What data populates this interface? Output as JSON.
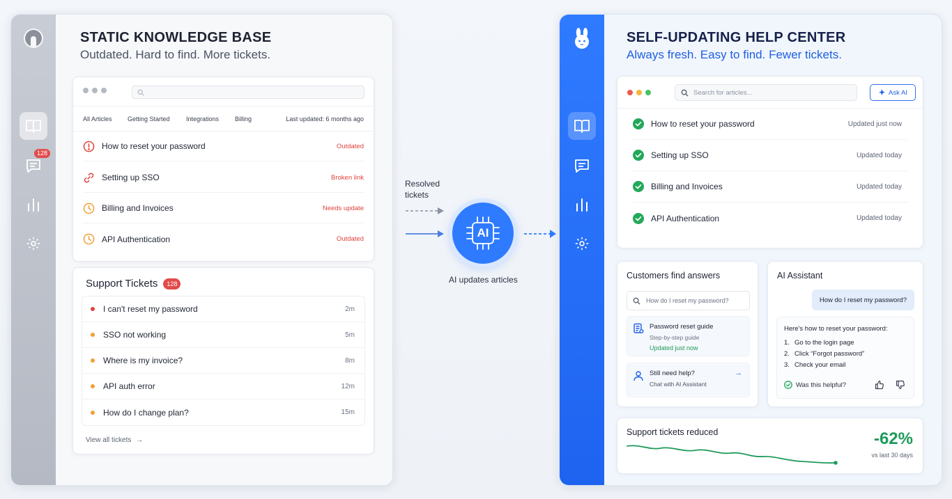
{
  "left_panel": {
    "title": "STATIC KNOWLEDGE BASE",
    "subtitle": "Outdated. Hard to find. More tickets.",
    "rail": {
      "chat_badge": "128"
    },
    "kb": {
      "tabs": [
        "All Articles",
        "Getting Started",
        "Integrations",
        "Billing"
      ],
      "last_updated": "Last updated: 6 months ago",
      "articles": [
        {
          "title": "How to reset your password",
          "status": "Outdated",
          "icon": "alert-circle-icon"
        },
        {
          "title": "Setting up SSO",
          "status": "Broken link",
          "icon": "broken-link-icon"
        },
        {
          "title": "Billing and Invoices",
          "status": "Needs update",
          "icon": "clock-icon"
        },
        {
          "title": "API Authentication",
          "status": "Outdated",
          "icon": "clock-icon"
        }
      ]
    },
    "tickets": {
      "title": "Support Tickets",
      "count": "128",
      "items": [
        {
          "text": "I can't reset my password",
          "age": "2m",
          "color": "#e0433b"
        },
        {
          "text": "SSO not working",
          "age": "5m",
          "color": "#f0a035"
        },
        {
          "text": "Where is my invoice?",
          "age": "8m",
          "color": "#f0a035"
        },
        {
          "text": "API auth error",
          "age": "12m",
          "color": "#f0a035"
        },
        {
          "text": "How do I change plan?",
          "age": "15m",
          "color": "#f0a035"
        }
      ],
      "view_all": "View all tickets"
    }
  },
  "middle": {
    "resolved_line1": "Resolved",
    "resolved_line2": "tickets",
    "ai_badge": "AI",
    "ai_label": "AI updates articles"
  },
  "right_panel": {
    "title": "SELF-UPDATING HELP CENTER",
    "subtitle": "Always fresh. Easy to find. Fewer tickets.",
    "hc": {
      "search_placeholder": "Search for articles...",
      "ask_ai": "Ask AI",
      "articles": [
        {
          "title": "How to reset your password",
          "status": "Updated just now"
        },
        {
          "title": "Setting up SSO",
          "status": "Updated today"
        },
        {
          "title": "Billing and Invoices",
          "status": "Updated today"
        },
        {
          "title": "API Authentication",
          "status": "Updated today"
        }
      ]
    },
    "customers": {
      "title": "Customers find answers",
      "query": "How do I reset my password?",
      "guide_title": "Password reset guide",
      "guide_sub": "Step-by-step guide",
      "guide_status": "Updated just now",
      "help_title": "Still need help?",
      "help_sub": "Chat with AI Assistant"
    },
    "assistant": {
      "title": "AI Assistant",
      "question": "How do I reset my password?",
      "answer_intro": "Here's how to reset your password:",
      "steps": [
        {
          "n": "1.",
          "text": "Go to the login page"
        },
        {
          "n": "2.",
          "text": "Click “Forgot password”"
        },
        {
          "n": "3.",
          "text": "Check your email"
        }
      ],
      "helpful": "Was this helpful?"
    },
    "stats": {
      "title": "Support tickets reduced",
      "value": "-62%",
      "sub": "vs last 30 days",
      "trend_color": "#1f9a5b"
    }
  },
  "colors": {
    "accent_blue": "#2f7bff",
    "success_green": "#22a85a",
    "alert_red": "#e0433b",
    "warn_orange": "#f0a035"
  }
}
